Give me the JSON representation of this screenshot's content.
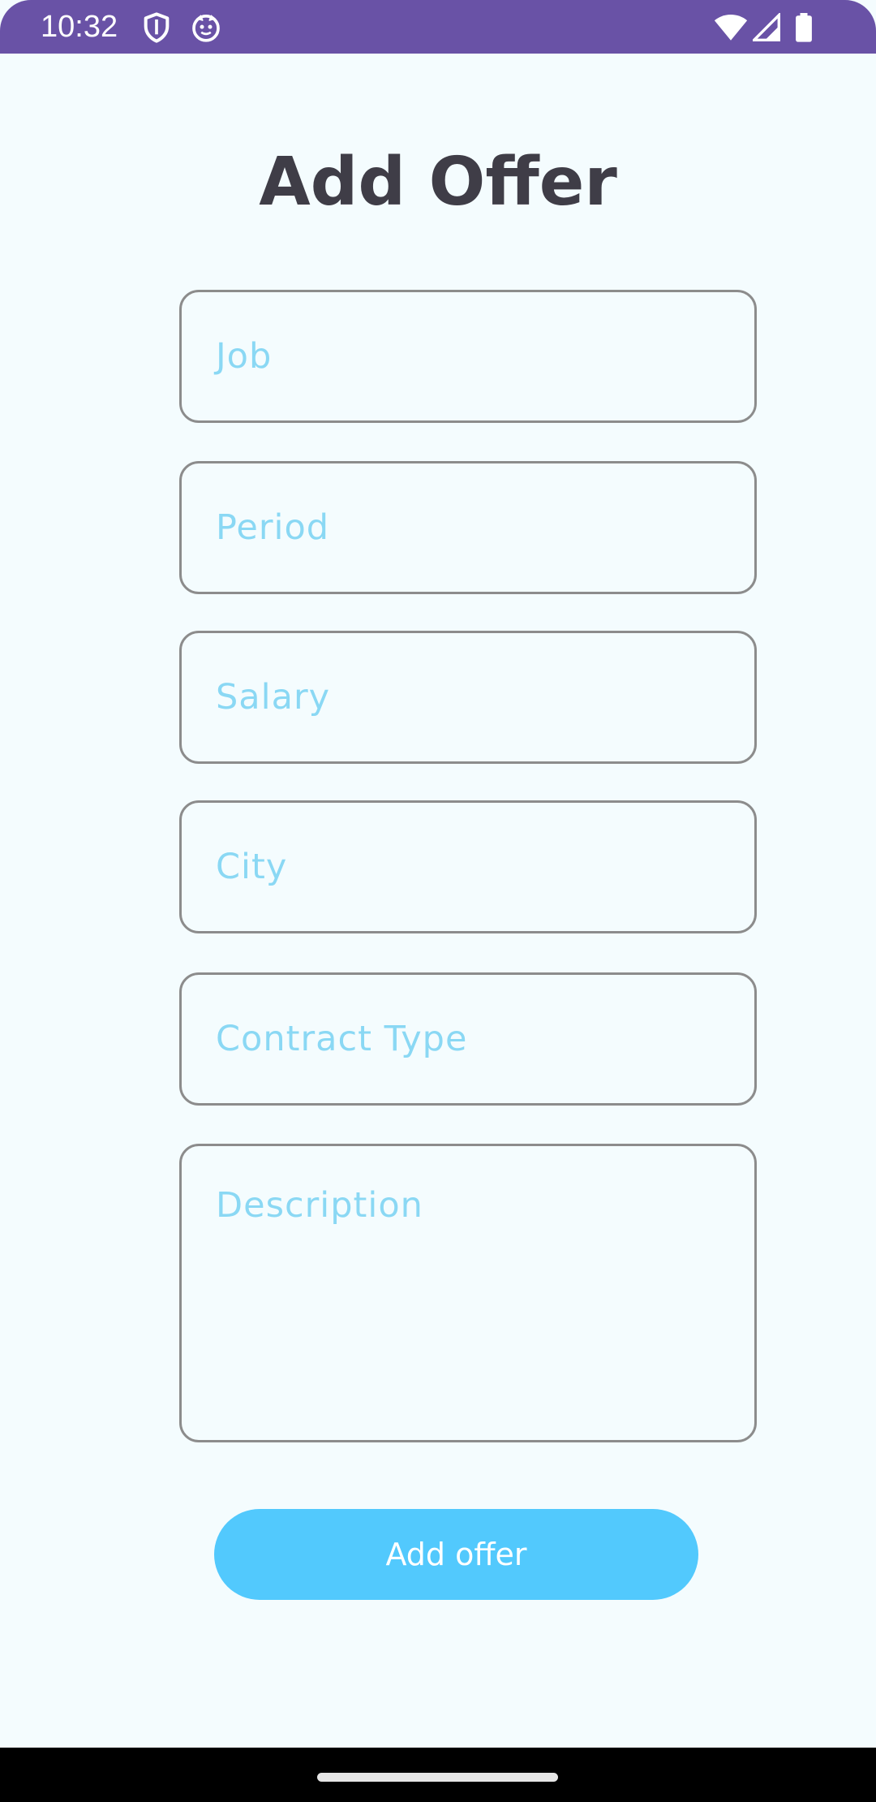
{
  "status_bar": {
    "time": "10:32",
    "background_color": "#6952a6",
    "left_icons": [
      "shield-icon",
      "cat-face-icon"
    ],
    "right_icons": [
      "wifi-icon",
      "cellular-signal-icon",
      "battery-icon"
    ]
  },
  "form": {
    "title": "Add Offer",
    "fields": {
      "job": {
        "placeholder": "Job",
        "value": ""
      },
      "period": {
        "placeholder": "Period",
        "value": ""
      },
      "salary": {
        "placeholder": "Salary",
        "value": ""
      },
      "city": {
        "placeholder": "City",
        "value": ""
      },
      "contract_type": {
        "placeholder": "Contract Type",
        "value": ""
      },
      "description": {
        "placeholder": "Description",
        "value": ""
      }
    },
    "submit_label": "Add offer"
  },
  "colors": {
    "background": "#f4fcfe",
    "title": "#3f3d47",
    "placeholder": "#8ad8f4",
    "field_border": "#8c8c8c",
    "button": "#52c9fd",
    "button_text": "#ffffff"
  }
}
